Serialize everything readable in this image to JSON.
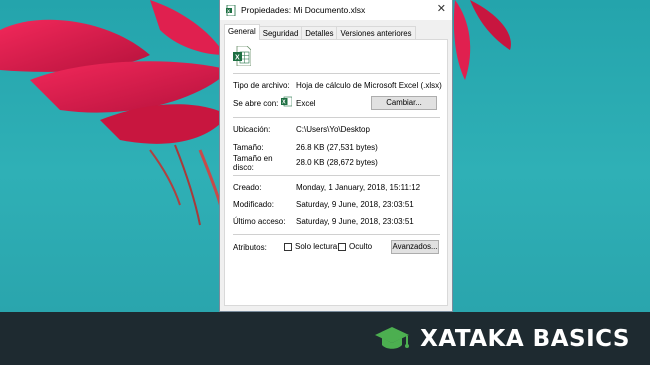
{
  "window": {
    "title": "Propiedades: Mi Documento.xlsx",
    "close_glyph": "✕"
  },
  "tabs": [
    {
      "label": "General",
      "active": true
    },
    {
      "label": "Seguridad"
    },
    {
      "label": "Detalles"
    },
    {
      "label": "Versiones anteriores"
    }
  ],
  "general": {
    "file_type_label": "Tipo de archivo:",
    "file_type_value": "Hoja de cálculo de Microsoft Excel (.xlsx)",
    "opens_with_label": "Se abre con:",
    "opens_with_value": "Excel",
    "change_button": "Cambiar...",
    "location_label": "Ubicación:",
    "location_value": "C:\\Users\\Yo\\Desktop",
    "size_label": "Tamaño:",
    "size_value": "26.8 KB (27,531 bytes)",
    "size_on_disk_label_1": "Tamaño en",
    "size_on_disk_label_2": "disco:",
    "size_on_disk_value": "28.0 KB (28,672 bytes)",
    "created_label": "Creado:",
    "created_value": "Monday, 1 January, 2018, 15:11:12",
    "modified_label": "Modificado:",
    "modified_value": "Saturday, 9 June, 2018, 23:03:51",
    "accessed_label": "Último acceso:",
    "accessed_value": "Saturday, 9 June, 2018, 23:03:51",
    "attributes_label": "Atributos:",
    "readonly_label": "Solo lectura",
    "hidden_label": "Oculto",
    "advanced_button": "Avanzados..."
  },
  "footer": {
    "brand": "XATAKA BASICS"
  },
  "colors": {
    "excel_green": "#1d6f42",
    "brand_green": "#4caf50",
    "flower_pink": "#d81b4a",
    "background_teal": "#2aa6ad"
  }
}
